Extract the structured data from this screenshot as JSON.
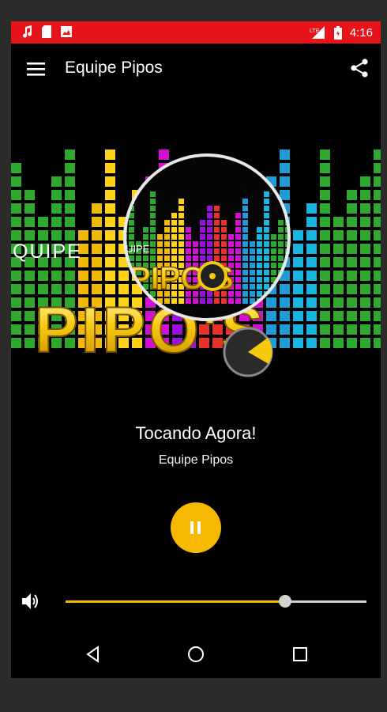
{
  "statusbar": {
    "network": "LTE",
    "time": "4:16",
    "icons": [
      "music-note-icon",
      "sd-card-icon",
      "image-icon",
      "signal-icon",
      "battery-icon"
    ]
  },
  "toolbar": {
    "title": "Equipe Pipos",
    "menu_icon": "hamburger-menu-icon",
    "share_icon": "share-icon"
  },
  "artwork": {
    "logo_small_top": "QUIPE",
    "logo_small_main": "PIPO'S",
    "logo_large_top": "QUIPE",
    "logo_large_main": "PIPO'S"
  },
  "player": {
    "now_playing": "Tocando Agora!",
    "station": "Equipe Pipos",
    "state_icon": "pause-icon",
    "accent_color": "#f6b800"
  },
  "volume": {
    "icon": "volume-icon",
    "level": 0.73
  },
  "navbar": {
    "icons": [
      "back-icon",
      "home-icon",
      "recents-icon"
    ]
  }
}
